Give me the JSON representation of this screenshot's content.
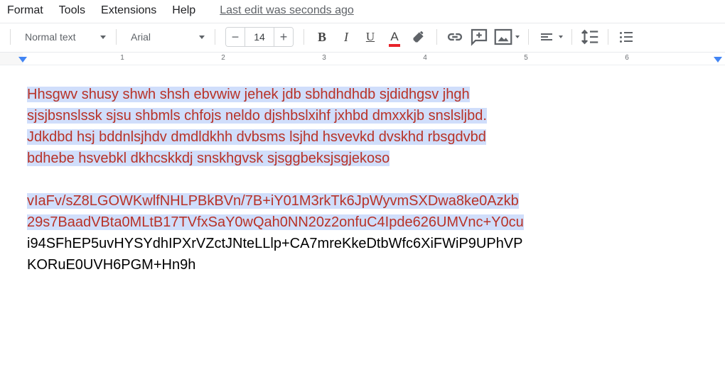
{
  "menubar": {
    "format": "Format",
    "tools": "Tools",
    "extensions": "Extensions",
    "help": "Help",
    "last_edit": "Last edit was seconds ago"
  },
  "toolbar": {
    "style_label": "Normal text",
    "font_label": "Arial",
    "font_size": "14"
  },
  "ruler": {
    "n1": "1",
    "n2": "2",
    "n3": "3",
    "n4": "4",
    "n5": "5",
    "n6": "6"
  },
  "doc": {
    "p1_l1": "Hhsgwv shusy shwh shsh ebvwiw jehek jdb sbhdhdhdb sjdidhgsv jhgh",
    "p1_l2": "sjsjbsnslssk sjsu shbmls chfojs neldo djshbslxihf jxhbd dmxxkjb snslsljbd.",
    "p1_l3": "Jdkdbd hsj bddnlsjhdv dmdldkhh dvbsms lsjhd hsvevkd dvskhd rbsgdvbd",
    "p1_l4": "bdhebe hsvebkl dkhcskkdj snskhgvsk sjsggbeksjsgjekoso",
    "p2_l1": "vIaFv/sZ8LGOWKwlfNHLPBkBVn/7B+iY01M3rkTk6JpWyvmSXDwa8ke0Azkb",
    "p2_l2": "29s7BaadVBta0MLtB17TVfxSaY0wQah0NN20z2onfuC4Ipde626UMVnc+Y0cu",
    "p2_l3": "i94SFhEP5uvHYSYdhIPXrVZctJNteLLlp+CA7mreKkeDtbWfc6XiFWiP9UPhVP",
    "p2_l4": "KORuE0UVH6PGM+Hn9h"
  }
}
